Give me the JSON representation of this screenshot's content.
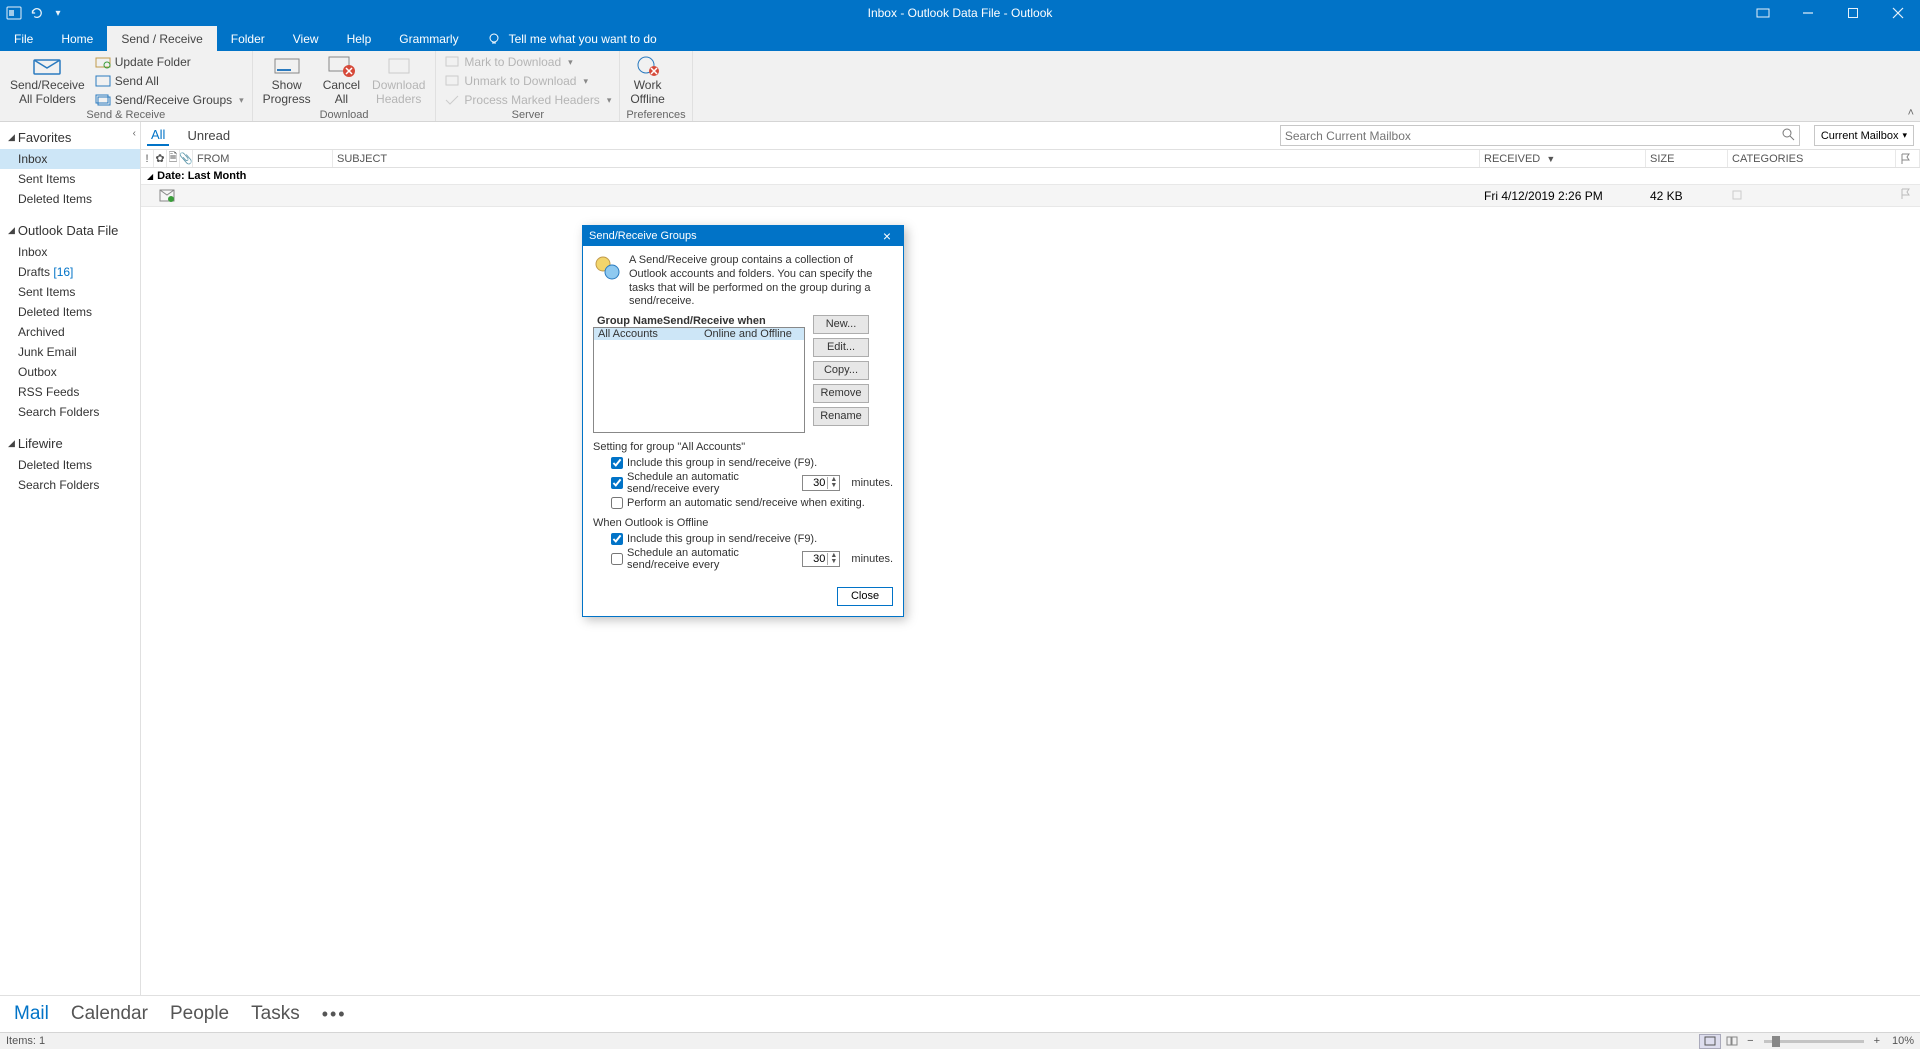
{
  "window": {
    "title": "Inbox - Outlook Data File  -  Outlook"
  },
  "menubar": {
    "tabs": [
      "File",
      "Home",
      "Send / Receive",
      "Folder",
      "View",
      "Help",
      "Grammarly"
    ],
    "active_index": 2,
    "tell_me": "Tell me what you want to do"
  },
  "ribbon": {
    "groups": {
      "send_receive": {
        "label": "Send & Receive",
        "big_btn": {
          "line1": "Send/Receive",
          "line2": "All Folders"
        },
        "small": [
          "Update Folder",
          "Send All",
          "Send/Receive Groups"
        ]
      },
      "download": {
        "label": "Download",
        "show_progress": {
          "line1": "Show",
          "line2": "Progress"
        },
        "cancel_all": {
          "line1": "Cancel",
          "line2": "All"
        },
        "download_headers": {
          "line1": "Download",
          "line2": "Headers"
        }
      },
      "server": {
        "label": "Server",
        "items": [
          "Mark to Download",
          "Unmark to Download",
          "Process Marked Headers"
        ]
      },
      "preferences": {
        "label": "Preferences",
        "work_offline": {
          "line1": "Work",
          "line2": "Offline"
        }
      }
    }
  },
  "sidebar": {
    "sections": [
      {
        "title": "Favorites",
        "items": [
          {
            "label": "Inbox",
            "selected": true
          },
          {
            "label": "Sent Items"
          },
          {
            "label": "Deleted Items"
          }
        ]
      },
      {
        "title": "Outlook Data File",
        "items": [
          {
            "label": "Inbox"
          },
          {
            "label": "Drafts",
            "count": "[16]"
          },
          {
            "label": "Sent Items"
          },
          {
            "label": "Deleted Items"
          },
          {
            "label": "Archived"
          },
          {
            "label": "Junk Email"
          },
          {
            "label": "Outbox"
          },
          {
            "label": "RSS Feeds"
          },
          {
            "label": "Search Folders"
          }
        ]
      },
      {
        "title": "Lifewire",
        "items": [
          {
            "label": "Deleted Items"
          },
          {
            "label": "Search Folders"
          }
        ]
      }
    ]
  },
  "maillist": {
    "filters": [
      "All",
      "Unread"
    ],
    "active_filter": 0,
    "search_placeholder": "Search Current Mailbox",
    "scope": "Current Mailbox",
    "columns": {
      "from": "FROM",
      "subject": "SUBJECT",
      "received": "RECEIVED",
      "size": "SIZE",
      "categories": "CATEGORIES"
    },
    "group_label": "Date: Last Month",
    "rows": [
      {
        "received": "Fri 4/12/2019 2:26 PM",
        "size": "42 KB"
      }
    ]
  },
  "bottom_nav": [
    "Mail",
    "Calendar",
    "People",
    "Tasks"
  ],
  "bottom_nav_active": 0,
  "statusbar": {
    "items_label": "Items: 1",
    "zoom": "10%"
  },
  "dialog": {
    "title": "Send/Receive Groups",
    "description": "A Send/Receive group contains a collection of Outlook accounts and folders. You can specify the tasks that will be performed on the group during a send/receive.",
    "col1": "Group Name",
    "col2": "Send/Receive when",
    "row_name": "All Accounts",
    "row_when": "Online and Offline",
    "buttons": [
      "New...",
      "Edit...",
      "Copy...",
      "Remove",
      "Rename"
    ],
    "setting_for": "Setting for group \"All Accounts\"",
    "chk_include_online": "Include this group in send/receive (F9).",
    "chk_schedule": "Schedule an automatic send/receive every",
    "minutes_label": "minutes.",
    "spin_online": "30",
    "chk_perform_exit": "Perform an automatic send/receive when exiting.",
    "offline_header": "When Outlook is Offline",
    "chk_include_offline": "Include this group in send/receive (F9).",
    "chk_schedule_offline": "Schedule an automatic send/receive every",
    "spin_offline": "30",
    "close": "Close"
  }
}
